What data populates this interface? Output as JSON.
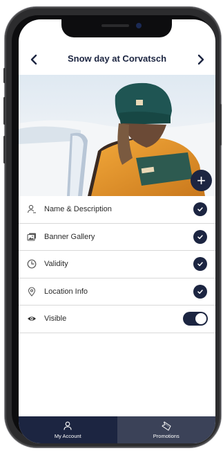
{
  "header": {
    "title": "Snow day at Corvatsch",
    "prev_icon": "chevron-left-icon",
    "next_icon": "chevron-right-icon"
  },
  "banner": {
    "add_label": "+"
  },
  "list": {
    "items": [
      {
        "label": "Name & Description",
        "icon": "person-badge-icon",
        "completed": true
      },
      {
        "label": "Banner Gallery",
        "icon": "gallery-icon",
        "completed": true
      },
      {
        "label": "Validity",
        "icon": "clock-icon",
        "completed": true
      },
      {
        "label": "Location Info",
        "icon": "location-pin-icon",
        "completed": true
      }
    ],
    "visible": {
      "label": "Visible",
      "icon": "eye-icon",
      "enabled": true
    }
  },
  "tabbar": {
    "tabs": [
      {
        "label": "My Account",
        "icon": "person-icon",
        "active": true
      },
      {
        "label": "Promotions",
        "icon": "ticket-icon",
        "active": false
      }
    ]
  },
  "colors": {
    "primary": "#1c2541",
    "tab_inactive": "#3b4258",
    "divider": "#d8d8d8"
  }
}
